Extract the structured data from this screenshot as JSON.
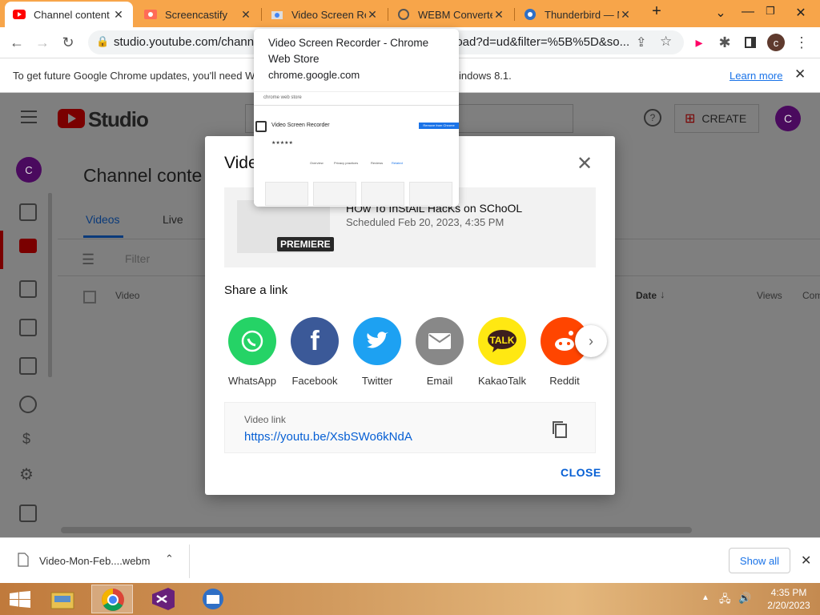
{
  "browser": {
    "tabs": [
      {
        "title": "Channel content",
        "icon": "youtube-icon",
        "active": true
      },
      {
        "title": "Screencastify",
        "icon": "screencastify-icon",
        "active": false
      },
      {
        "title": "Video Screen Recor",
        "icon": "chrome-webstore-icon",
        "active": false
      },
      {
        "title": "WEBM Converter",
        "icon": "converter-icon",
        "active": false
      },
      {
        "title": "Thunderbird — M",
        "icon": "thunderbird-icon",
        "active": false
      }
    ],
    "new_tab": "+",
    "url": "studio.youtube.com/channel",
    "url_tail": "load?d=ud&filter=%5B%5D&so...",
    "profile_initial": "c"
  },
  "infobar": {
    "text": "To get future Google Chrome updates, you'll need W",
    "text_tail": "indows 8.1.",
    "learn_more": "Learn more"
  },
  "hovercard": {
    "title": "Video Screen Recorder - Chrome Web Store",
    "domain": "chrome.google.com",
    "preview": {
      "site": "chrome web store",
      "ext_name": "Video Screen Recorder",
      "install": "Remove from Chrome",
      "tabs": [
        "Overview",
        "Privacy practices",
        "Reviews",
        "Related"
      ]
    }
  },
  "studio": {
    "logo": "Studio",
    "create": "CREATE",
    "avatar": "C",
    "page_title": "Channel conte",
    "tabs": [
      "Videos",
      "Live"
    ],
    "filter": "Filter",
    "col_video": "Video",
    "col_date": "Date",
    "col_views": "Views",
    "col_comments": "Com"
  },
  "dialog": {
    "title": "Video",
    "video_title": "HOw To InStAlL HacKs on SChoOL",
    "scheduled": "Scheduled Feb 20, 2023, 4:35 PM",
    "badge": "PREMIERE",
    "share_label": "Share a link",
    "share_targets": [
      {
        "label": "WhatsApp",
        "color": "#25d366",
        "icon": "whatsapp-icon"
      },
      {
        "label": "Facebook",
        "color": "#3b5998",
        "icon": "facebook-icon"
      },
      {
        "label": "Twitter",
        "color": "#1da1f2",
        "icon": "twitter-icon"
      },
      {
        "label": "Email",
        "color": "#888888",
        "icon": "email-icon"
      },
      {
        "label": "KakaoTalk",
        "color": "#ffe812",
        "icon": "kakaotalk-icon"
      },
      {
        "label": "Reddit",
        "color": "#ff4500",
        "icon": "reddit-icon"
      }
    ],
    "link_label": "Video link",
    "link_url": "https://youtu.be/XsbSWo6kNdA",
    "close": "CLOSE"
  },
  "downloads": {
    "file": "Video-Mon-Feb....webm",
    "show_all": "Show all"
  },
  "taskbar": {
    "time": "4:35 PM",
    "date": "2/20/2023"
  }
}
